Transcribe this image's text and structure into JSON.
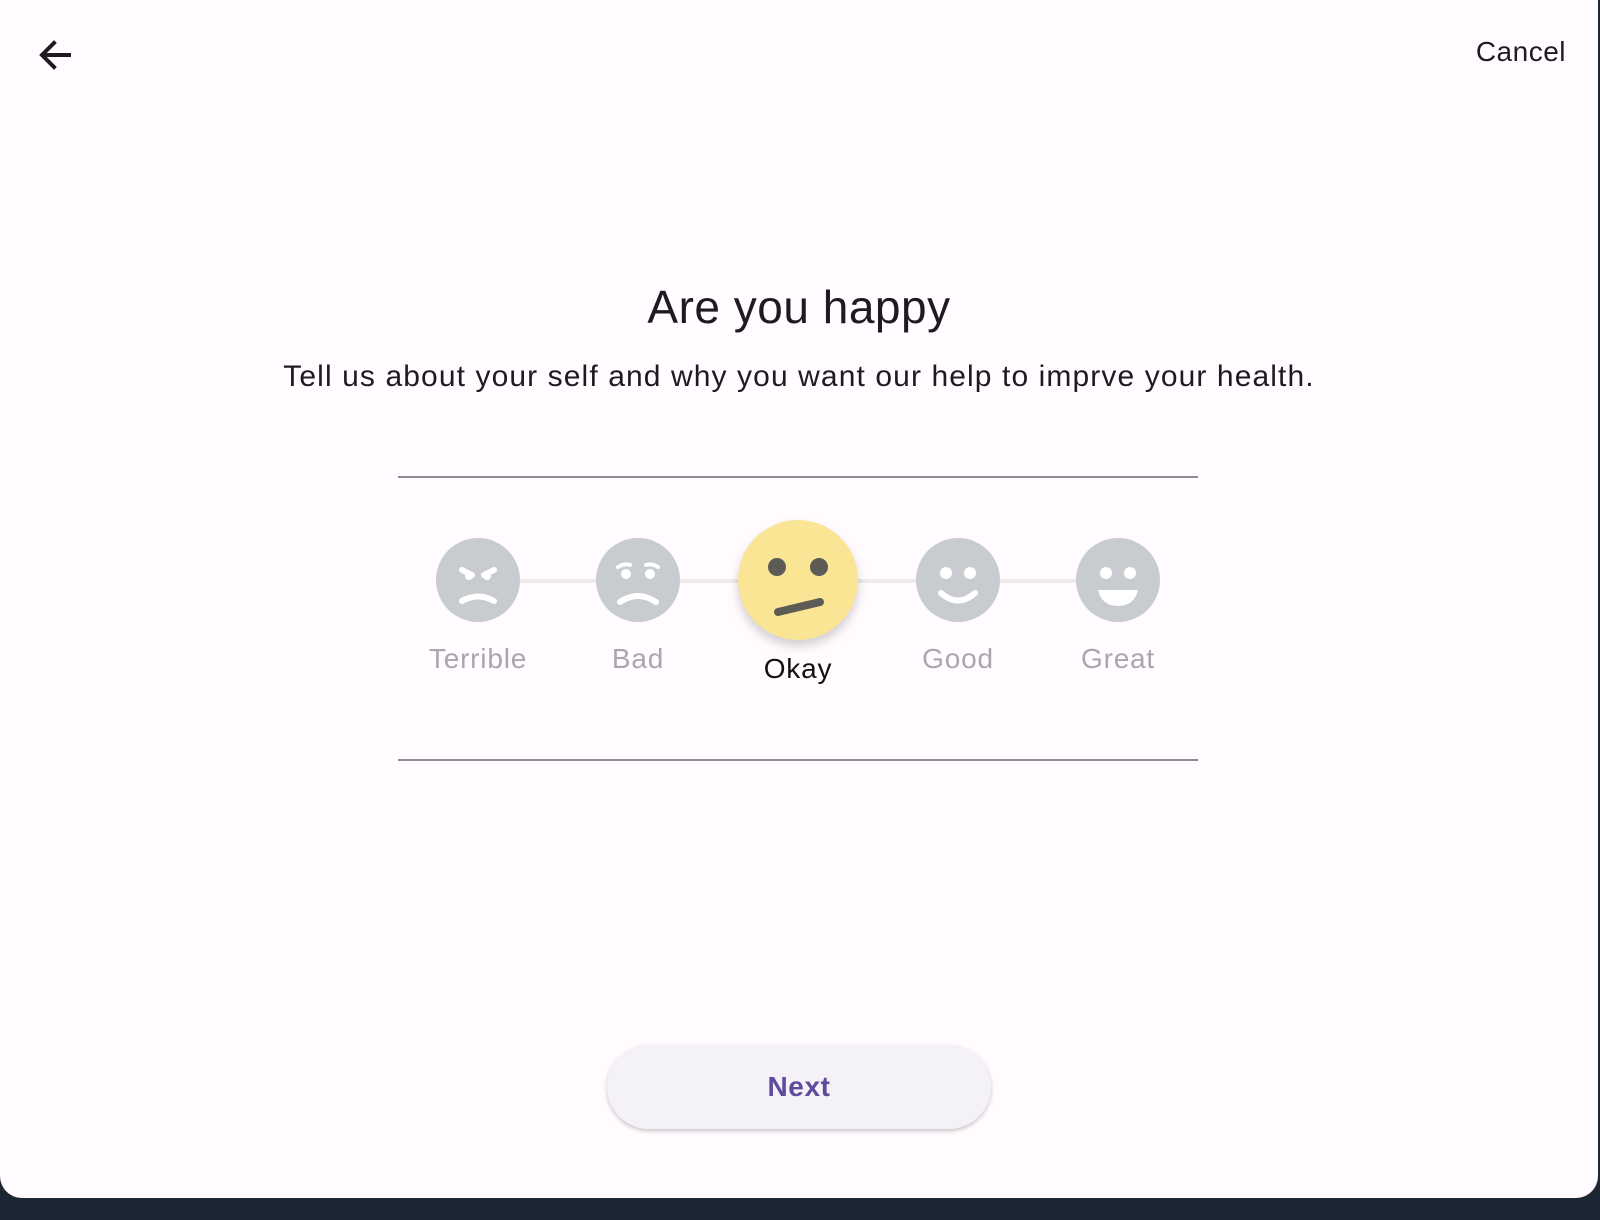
{
  "header": {
    "back_icon": "arrow-left-icon",
    "cancel_label": "Cancel"
  },
  "main": {
    "title": "Are you happy",
    "subtitle": "Tell us about your self and why you want our help to imprve your health."
  },
  "rating": {
    "selected_index": 2,
    "options": [
      {
        "label": "Terrible",
        "icon": "terrible-face-icon"
      },
      {
        "label": "Bad",
        "icon": "bad-face-icon"
      },
      {
        "label": "Okay",
        "icon": "okay-face-icon"
      },
      {
        "label": "Good",
        "icon": "good-face-icon"
      },
      {
        "label": "Great",
        "icon": "great-face-icon"
      }
    ]
  },
  "footer": {
    "next_label": "Next"
  },
  "colors": {
    "background": "#fffbfe",
    "selected_face": "#f9e594",
    "unselected_face": "#c8cbcf",
    "primary": "#5f4b9e"
  }
}
